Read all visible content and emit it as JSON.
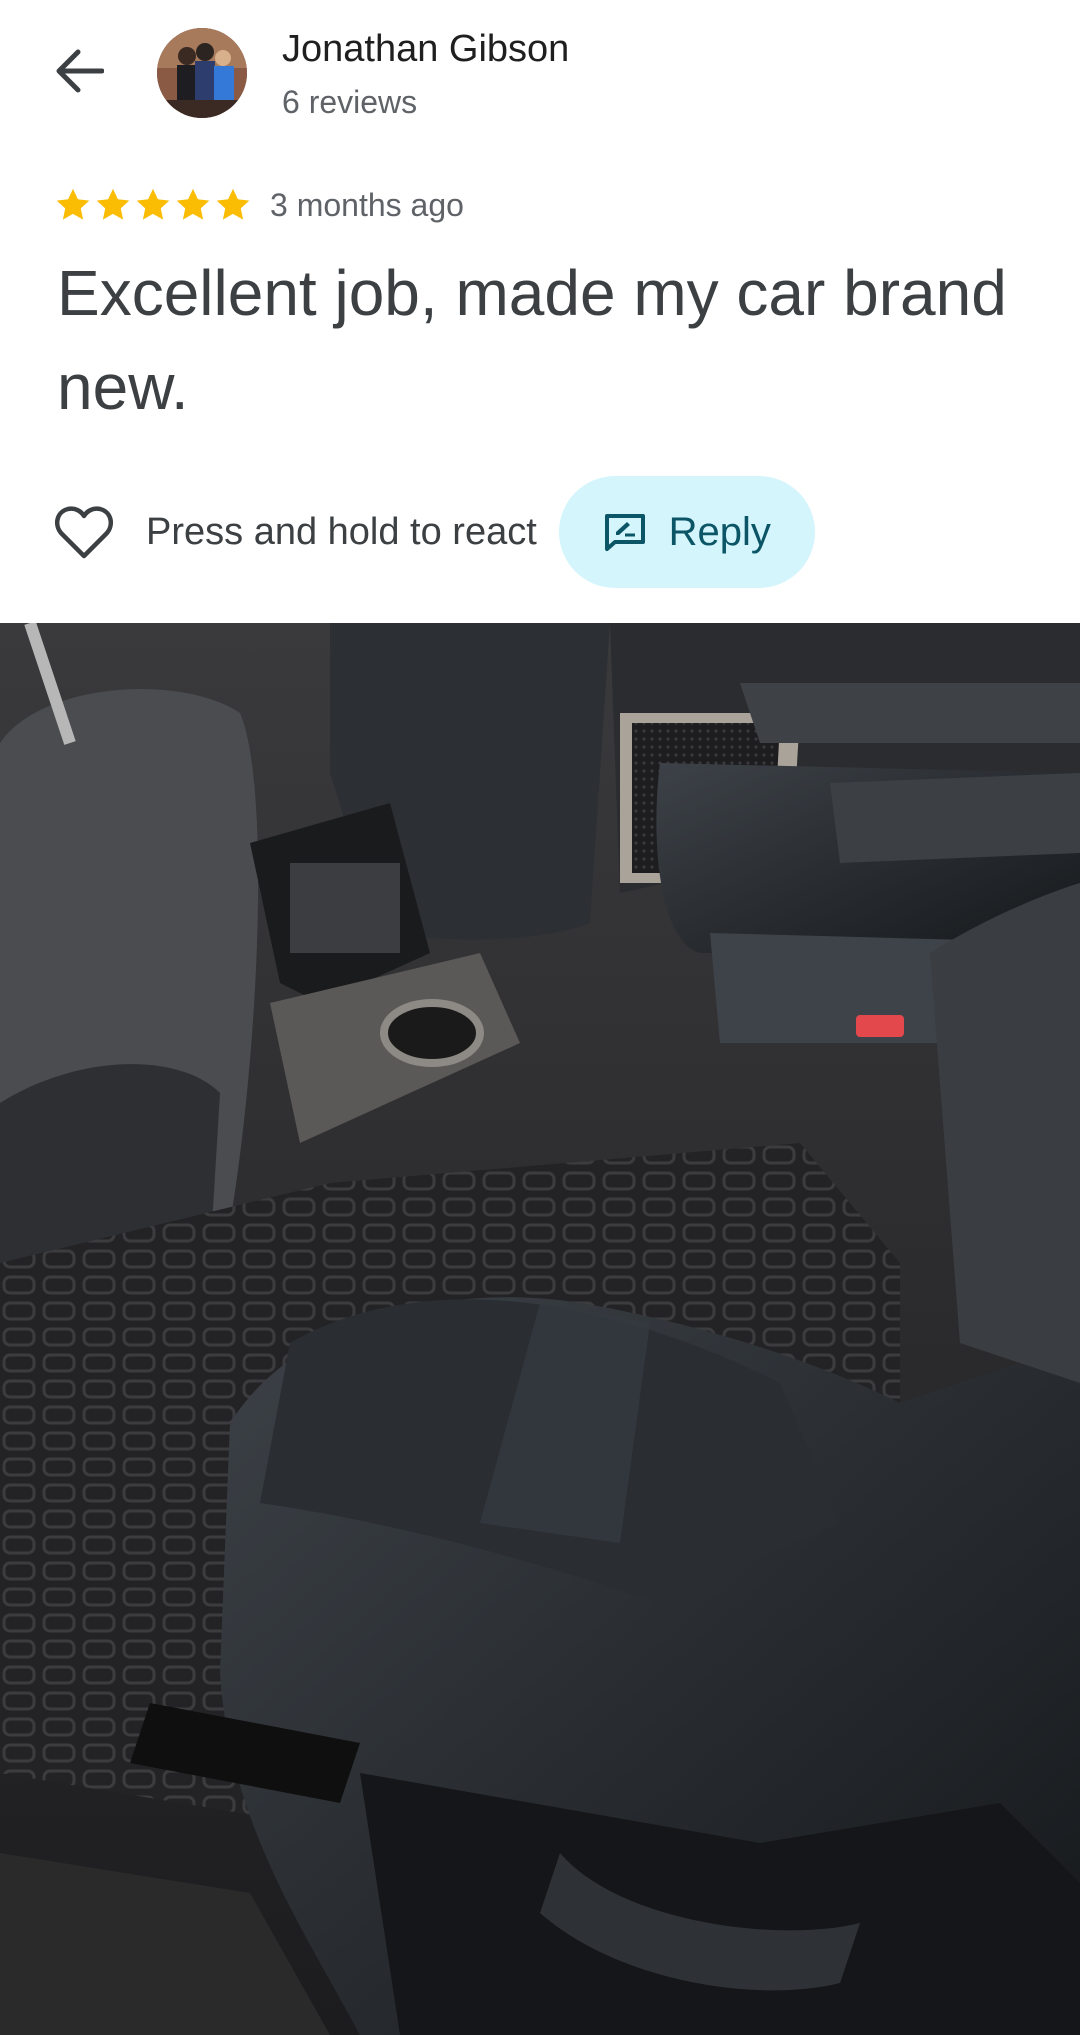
{
  "header": {
    "back_icon": "arrow-back-icon",
    "reviewer_name": "Jonathan Gibson",
    "reviewer_meta": "6 reviews"
  },
  "review": {
    "rating": 5,
    "rating_max": 5,
    "star_color": "#fbbc04",
    "time": "3 months ago",
    "text": "Excellent job, made my car brand new."
  },
  "actions": {
    "react_icon": "heart-outline-icon",
    "react_label": "Press and hold to react",
    "reply_icon": "rate-review-icon",
    "reply_label": "Reply",
    "reply_bg": "#d3f5fb",
    "reply_color": "#0b5566"
  },
  "photo": {
    "subject": "car-interior-photo"
  }
}
